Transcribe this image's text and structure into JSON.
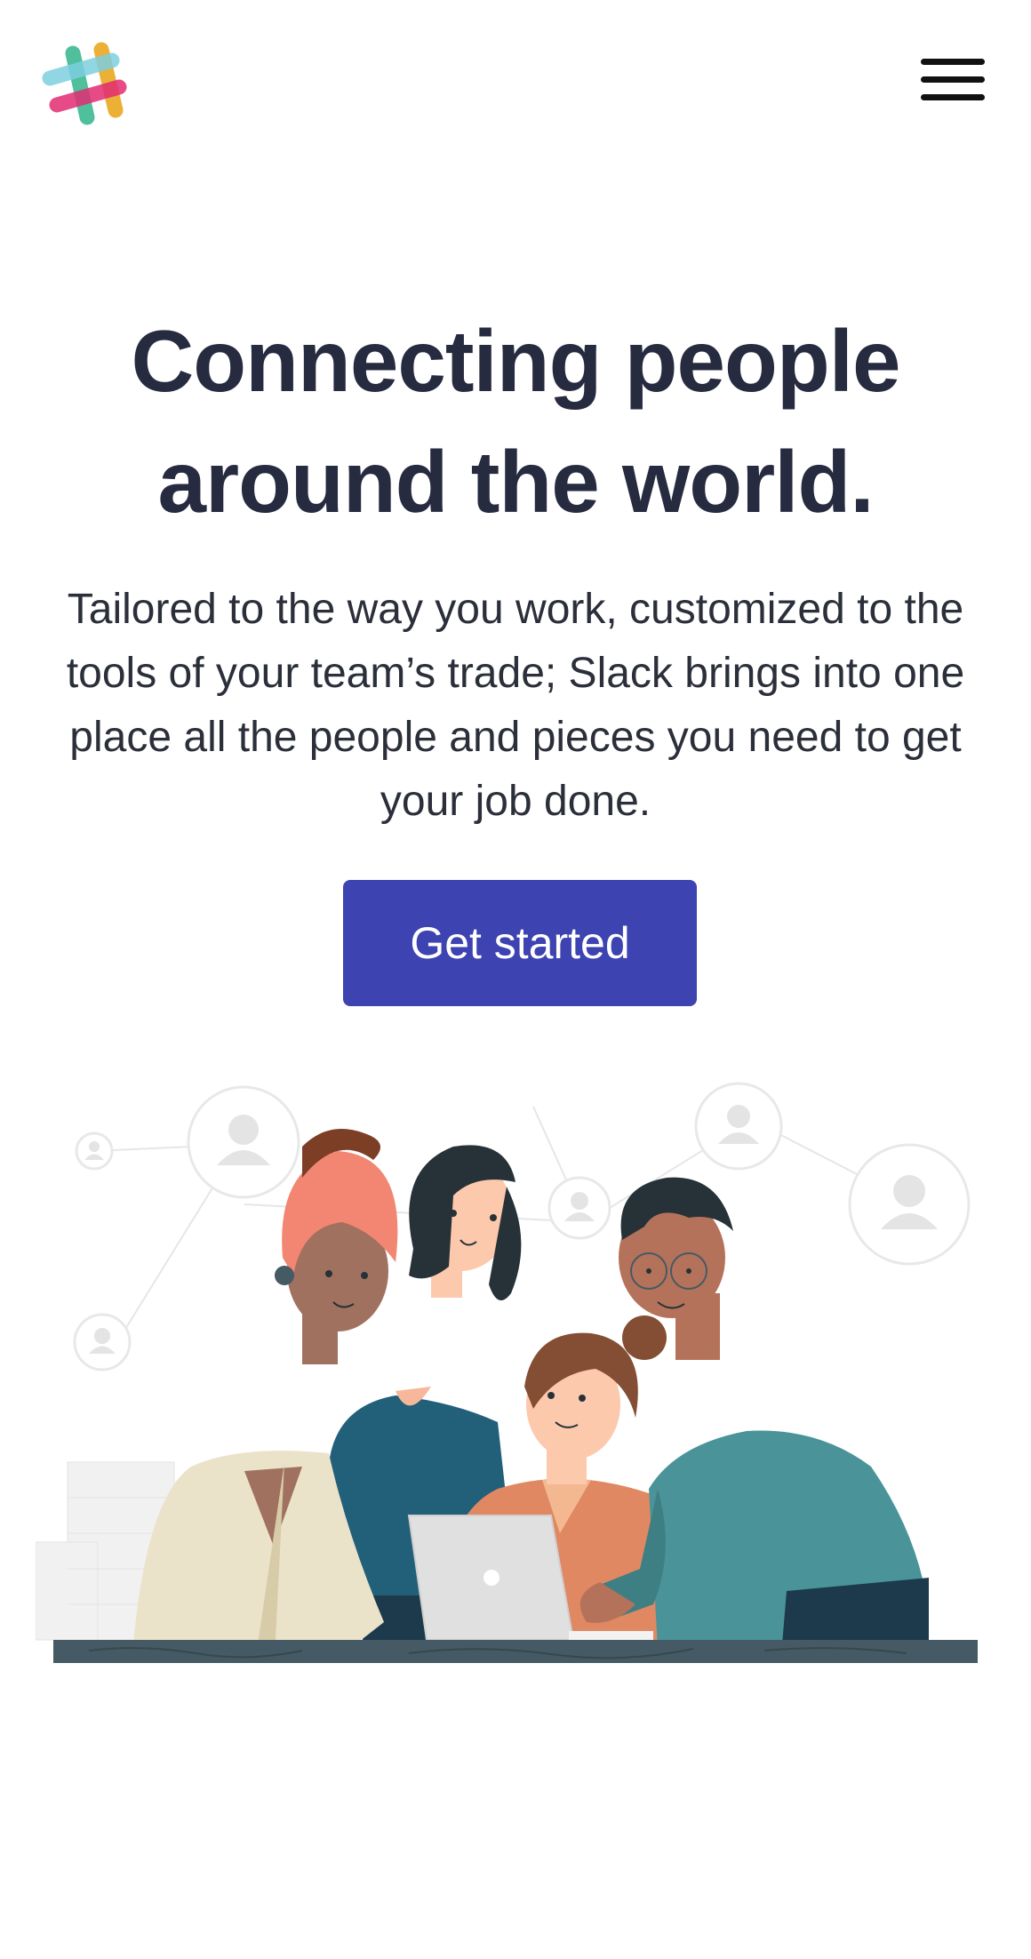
{
  "header": {
    "logo_icon": "slack-logo-icon",
    "menu_icon": "hamburger-menu-icon"
  },
  "hero": {
    "title_line1": "Connecting people",
    "title_line2": "around the world.",
    "subtitle": "Tailored to the way you work, customized to the tools of your team’s trade; Slack brings into one place all the people and pieces you need to get your job done.",
    "cta_label": "Get started"
  },
  "colors": {
    "cta_background": "#3d43b1",
    "heading": "#262b40",
    "logo_teal": "#3eb991",
    "logo_blue": "#70cadb",
    "logo_yellow": "#e9a820",
    "logo_pink": "#e01563"
  },
  "illustration": {
    "icon": "team-collaboration-illustration"
  }
}
